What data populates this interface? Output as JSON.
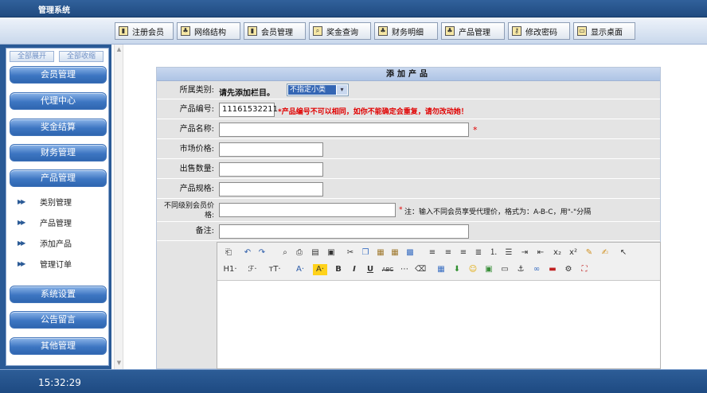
{
  "app": {
    "title": "管理系统"
  },
  "toolbar": [
    {
      "label": "注册会员",
      "icon": "document-icon"
    },
    {
      "label": "网络结构",
      "icon": "tree-icon"
    },
    {
      "label": "会员管理",
      "icon": "document-icon"
    },
    {
      "label": "奖金查询",
      "icon": "search-icon"
    },
    {
      "label": "财务明细",
      "icon": "tree-icon"
    },
    {
      "label": "产品管理",
      "icon": "tree-icon"
    },
    {
      "label": "修改密码",
      "icon": "key-icon"
    },
    {
      "label": "显示桌面",
      "icon": "desktop-icon"
    }
  ],
  "sidebar": {
    "expand_all": "全部展开",
    "collapse_all": "全部收缩",
    "menus_top": [
      "会员管理",
      "代理中心",
      "奖金结算",
      "财务管理",
      "产品管理"
    ],
    "sub_items": [
      "类别管理",
      "产品管理",
      "添加产品",
      "管理订单"
    ],
    "menus_bottom": [
      "系统设置",
      "公告留言",
      "其他管理"
    ]
  },
  "form": {
    "title": "添加产品",
    "category": {
      "label": "所属类别:",
      "hint": "请先添加栏目。",
      "selected": "不指定小类"
    },
    "code": {
      "label": "产品编号:",
      "value": "11161532211",
      "note": "*产品编号不可以相同，如你不能确定会重复，请勿改动她！"
    },
    "name": {
      "label": "产品名称:",
      "value": "",
      "required_mark": "*"
    },
    "market_price": {
      "label": "市场价格:",
      "value": ""
    },
    "sale_qty": {
      "label": "出售数量:",
      "value": ""
    },
    "spec": {
      "label": "产品规格:",
      "value": ""
    },
    "level_price": {
      "label": "不同级别会员价格:",
      "value": "",
      "note_mark": "*",
      "note": "注：输入不同会员享受代理价，格式为：A-B-C，用\"-\"分隔"
    },
    "remark": {
      "label": "备注:",
      "value": ""
    }
  },
  "editor": {
    "row1": [
      "source",
      "undo",
      "redo",
      "preview",
      "print",
      "template",
      "code",
      "cut",
      "copy",
      "paste",
      "paste-text",
      "paste-word",
      "align-left",
      "align-center",
      "align-right",
      "justify",
      "ordered-list",
      "unordered-list",
      "indent",
      "outdent",
      "subscript",
      "superscript",
      "clear-format",
      "select-all",
      "cursor"
    ],
    "row2_labels": {
      "heading": "H1·",
      "font": "ℱ·",
      "size": "тT·",
      "color": "A·",
      "bg": "A·",
      "bold": "B",
      "italic": "I",
      "underline": "U",
      "strike": "ABC"
    }
  },
  "status": {
    "time": "15:32:29"
  }
}
